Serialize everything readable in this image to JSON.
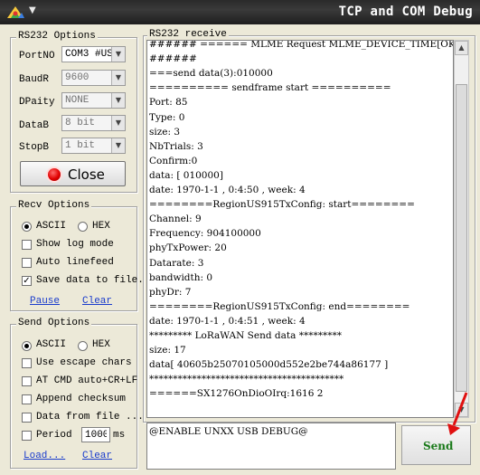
{
  "window": {
    "title": "TCP and COM Debug",
    "menu_arrow": "▼"
  },
  "rs232_options": {
    "label": "RS232 Options",
    "port_label": "PortNO",
    "port_value": "COM3 #US",
    "baud_label": "BaudR",
    "baud_value": "9600",
    "parity_label": "DPaity",
    "parity_value": "NONE",
    "databits_label": "DataB",
    "databits_value": "8 bit",
    "stopbits_label": "StopB",
    "stopbits_value": "1 bit",
    "close_label": "Close"
  },
  "recv_options": {
    "label": "Recv Options",
    "ascii": "ASCII",
    "hex": "HEX",
    "show_log": "Show log mode",
    "auto_linefeed": "Auto linefeed",
    "save_file": "Save data to file.",
    "pause": "Pause",
    "clear": "Clear"
  },
  "send_options": {
    "label": "Send Options",
    "ascii": "ASCII",
    "hex": "HEX",
    "escape": "Use escape chars",
    "at_cmd": "AT CMD auto+CR+LF",
    "checksum": "Append checksum",
    "from_file": "Data from file ...",
    "period": "Period",
    "period_value": "1000",
    "period_unit": "ms",
    "load": "Load...",
    "clear": "Clear"
  },
  "receive": {
    "label": "RS232 receive",
    "lines": [
      "###### ====== MLME Request   MLME_DEVICE_TIME[OK] ======",
      "######",
      "===send data(3):010000",
      "========== sendframe start ==========",
      "  Port: 85",
      "  Type: 0",
      "  size: 3",
      "  NbTrials: 3",
      "  Confirm:0",
      "  data: [ 010000]",
      "date: 1970-1-1 , 0:4:50 , week: 4",
      "========RegionUS915TxConfig: start========",
      "Channel: 9",
      "Frequency: 904100000",
      "phyTxPower: 20",
      "Datarate: 3",
      "bandwidth: 0",
      "phyDr: 7",
      "========RegionUS915TxConfig: end========",
      "date: 1970-1-1 , 0:4:51 , week: 4",
      "********* LoRaWAN Send data *********",
      " size: 17",
      " data[ 40605b25070105000d552e2be744a86177 ]",
      "*****************************************",
      "======SX1276OnDioOIrq:1616 2"
    ]
  },
  "send": {
    "input_text": "@ENABLE UNXX USB DEBUG@",
    "button_label": "Send"
  },
  "colors": {
    "link": "#1a3ccc",
    "send_text": "#1b7a1b",
    "arrow": "#e01010"
  }
}
